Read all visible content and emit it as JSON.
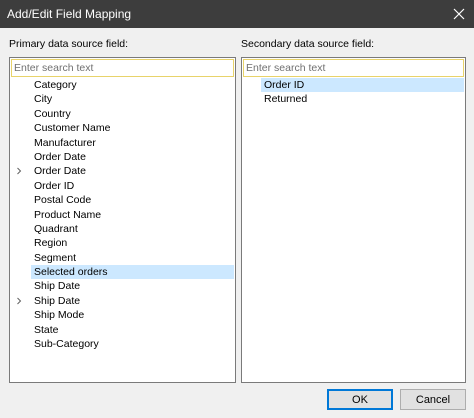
{
  "window": {
    "title": "Add/Edit Field Mapping"
  },
  "primary": {
    "label": "Primary data source field:",
    "search_placeholder": "Enter search text",
    "items": [
      {
        "label": "Category",
        "expandable": false,
        "selected": false
      },
      {
        "label": "City",
        "expandable": false,
        "selected": false
      },
      {
        "label": "Country",
        "expandable": false,
        "selected": false
      },
      {
        "label": "Customer Name",
        "expandable": false,
        "selected": false
      },
      {
        "label": "Manufacturer",
        "expandable": false,
        "selected": false
      },
      {
        "label": "Order Date",
        "expandable": false,
        "selected": false
      },
      {
        "label": "Order Date",
        "expandable": true,
        "selected": false
      },
      {
        "label": "Order ID",
        "expandable": false,
        "selected": false
      },
      {
        "label": "Postal Code",
        "expandable": false,
        "selected": false
      },
      {
        "label": "Product Name",
        "expandable": false,
        "selected": false
      },
      {
        "label": "Quadrant",
        "expandable": false,
        "selected": false
      },
      {
        "label": "Region",
        "expandable": false,
        "selected": false
      },
      {
        "label": "Segment",
        "expandable": false,
        "selected": false
      },
      {
        "label": "Selected orders",
        "expandable": false,
        "selected": true
      },
      {
        "label": "Ship Date",
        "expandable": false,
        "selected": false
      },
      {
        "label": "Ship Date",
        "expandable": true,
        "selected": false
      },
      {
        "label": "Ship Mode",
        "expandable": false,
        "selected": false
      },
      {
        "label": "State",
        "expandable": false,
        "selected": false
      },
      {
        "label": "Sub-Category",
        "expandable": false,
        "selected": false
      }
    ]
  },
  "secondary": {
    "label": "Secondary data source field:",
    "search_placeholder": "Enter search text",
    "items": [
      {
        "label": "Order ID",
        "selected": true
      },
      {
        "label": "Returned",
        "selected": false
      }
    ]
  },
  "buttons": {
    "ok_label": "OK",
    "cancel_label": "Cancel"
  },
  "icons": {
    "close": "close-icon",
    "expand": "chevron-right-icon"
  },
  "colors": {
    "titlebar": "#3d3d3d",
    "selection": "#cce8ff",
    "search_border": "#e8d36a",
    "default_button_border": "#0078d7"
  }
}
